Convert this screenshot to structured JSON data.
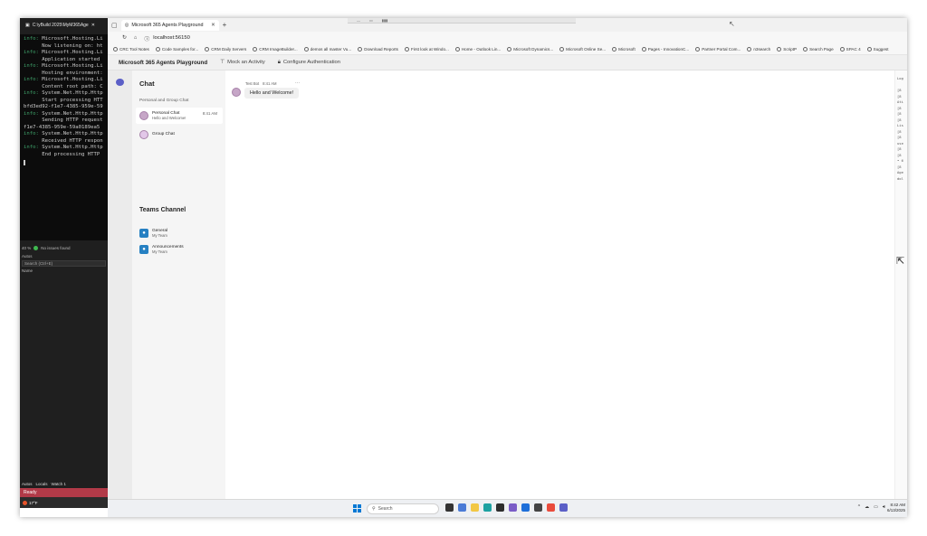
{
  "terminal": {
    "tab_title": "C:\\yBuild 2025\\MyM365Age",
    "lines": [
      {
        "level": "info:",
        "text": " Microsoft.Hosting.Li"
      },
      {
        "level": "",
        "text": "      Now listening on: ht"
      },
      {
        "level": "info:",
        "text": " Microsoft.Hosting.Li"
      },
      {
        "level": "",
        "text": "      Application started"
      },
      {
        "level": "info:",
        "text": " Microsoft.Hosting.Li"
      },
      {
        "level": "",
        "text": "      Hosting environment:"
      },
      {
        "level": "info:",
        "text": " Microsoft.Hosting.Li"
      },
      {
        "level": "",
        "text": "      Content root path: C"
      },
      {
        "level": "info:",
        "text": " System.Net.Http.Http"
      },
      {
        "level": "",
        "text": "      Start processing HTT"
      },
      {
        "level": "",
        "text": "bfd3ed92-f1e7-4385-959e-59"
      },
      {
        "level": "info:",
        "text": " System.Net.Http.Http"
      },
      {
        "level": "",
        "text": "      Sending HTTP request"
      },
      {
        "level": "",
        "text": "f1e7-4385-959e-59a0189ea5"
      },
      {
        "level": "info:",
        "text": " System.Net.Http.Http"
      },
      {
        "level": "",
        "text": "      Received HTTP respon"
      },
      {
        "level": "info:",
        "text": " System.Net.Http.Http"
      },
      {
        "level": "",
        "text": "      End processing HTTP"
      }
    ]
  },
  "vs": {
    "zoom": "40 %",
    "issues": "No issues found",
    "panel_title": "Autos",
    "search_placeholder": "Search (Ctrl+E)",
    "col_name": "Name",
    "bottom_tabs": [
      "Autos",
      "Locals",
      "Watch 1"
    ],
    "status": "Ready",
    "task_temp": "17°F"
  },
  "browser": {
    "tab_title": "Microsoft 365 Agents Playground",
    "url": "localhost:56150",
    "favorites": [
      "CRC Tool Notes",
      "Code Samples for...",
      "CRM Daily Servers",
      "CRM ImageBuilder...",
      "demos all master Vu...",
      "Download Reports",
      "First look at Windo...",
      "Home - Outlook Lin...",
      "Microsoft Dynamics...",
      "Microsoft Online Se...",
      "Microsoft",
      "Pages - InnovationC...",
      "Partner Portal Com...",
      "n3search",
      "ScriptP",
      "Search Page",
      "SPAC 4",
      "Suggest"
    ]
  },
  "app": {
    "title": "Microsoft 365 Agents Playground",
    "menu": [
      "Mock an Activity",
      "Configure Authentication"
    ]
  },
  "sidebar": {
    "title": "Chat",
    "section_label": "Personal and Group Chat",
    "chats": [
      {
        "name": "Personal Chat",
        "preview": "Hello and Welcome!",
        "time": "8:41 AM"
      },
      {
        "name": "Group Chat",
        "preview": "",
        "time": ""
      }
    ],
    "teams_title": "Teams Channel",
    "channels": [
      {
        "name": "General",
        "team": "My Team"
      },
      {
        "name": "Announcements",
        "team": "My Team"
      }
    ]
  },
  "conversation": {
    "sender": "Test Bot",
    "time": "8:41 AM",
    "message": "Hello and Welcome!"
  },
  "right_log": [
    "Log",
    "",
    "[8",
    "[8",
    "Ati",
    "[8",
    "[8",
    "[8",
    "Lis",
    "[8",
    "[8",
    "use",
    "[8",
    "[8",
    "• 6",
    "[8",
    "Age",
    "dol"
  ],
  "taskbar": {
    "search_placeholder": "Search",
    "time": "8:42 AM",
    "date": "6/13/2025"
  }
}
